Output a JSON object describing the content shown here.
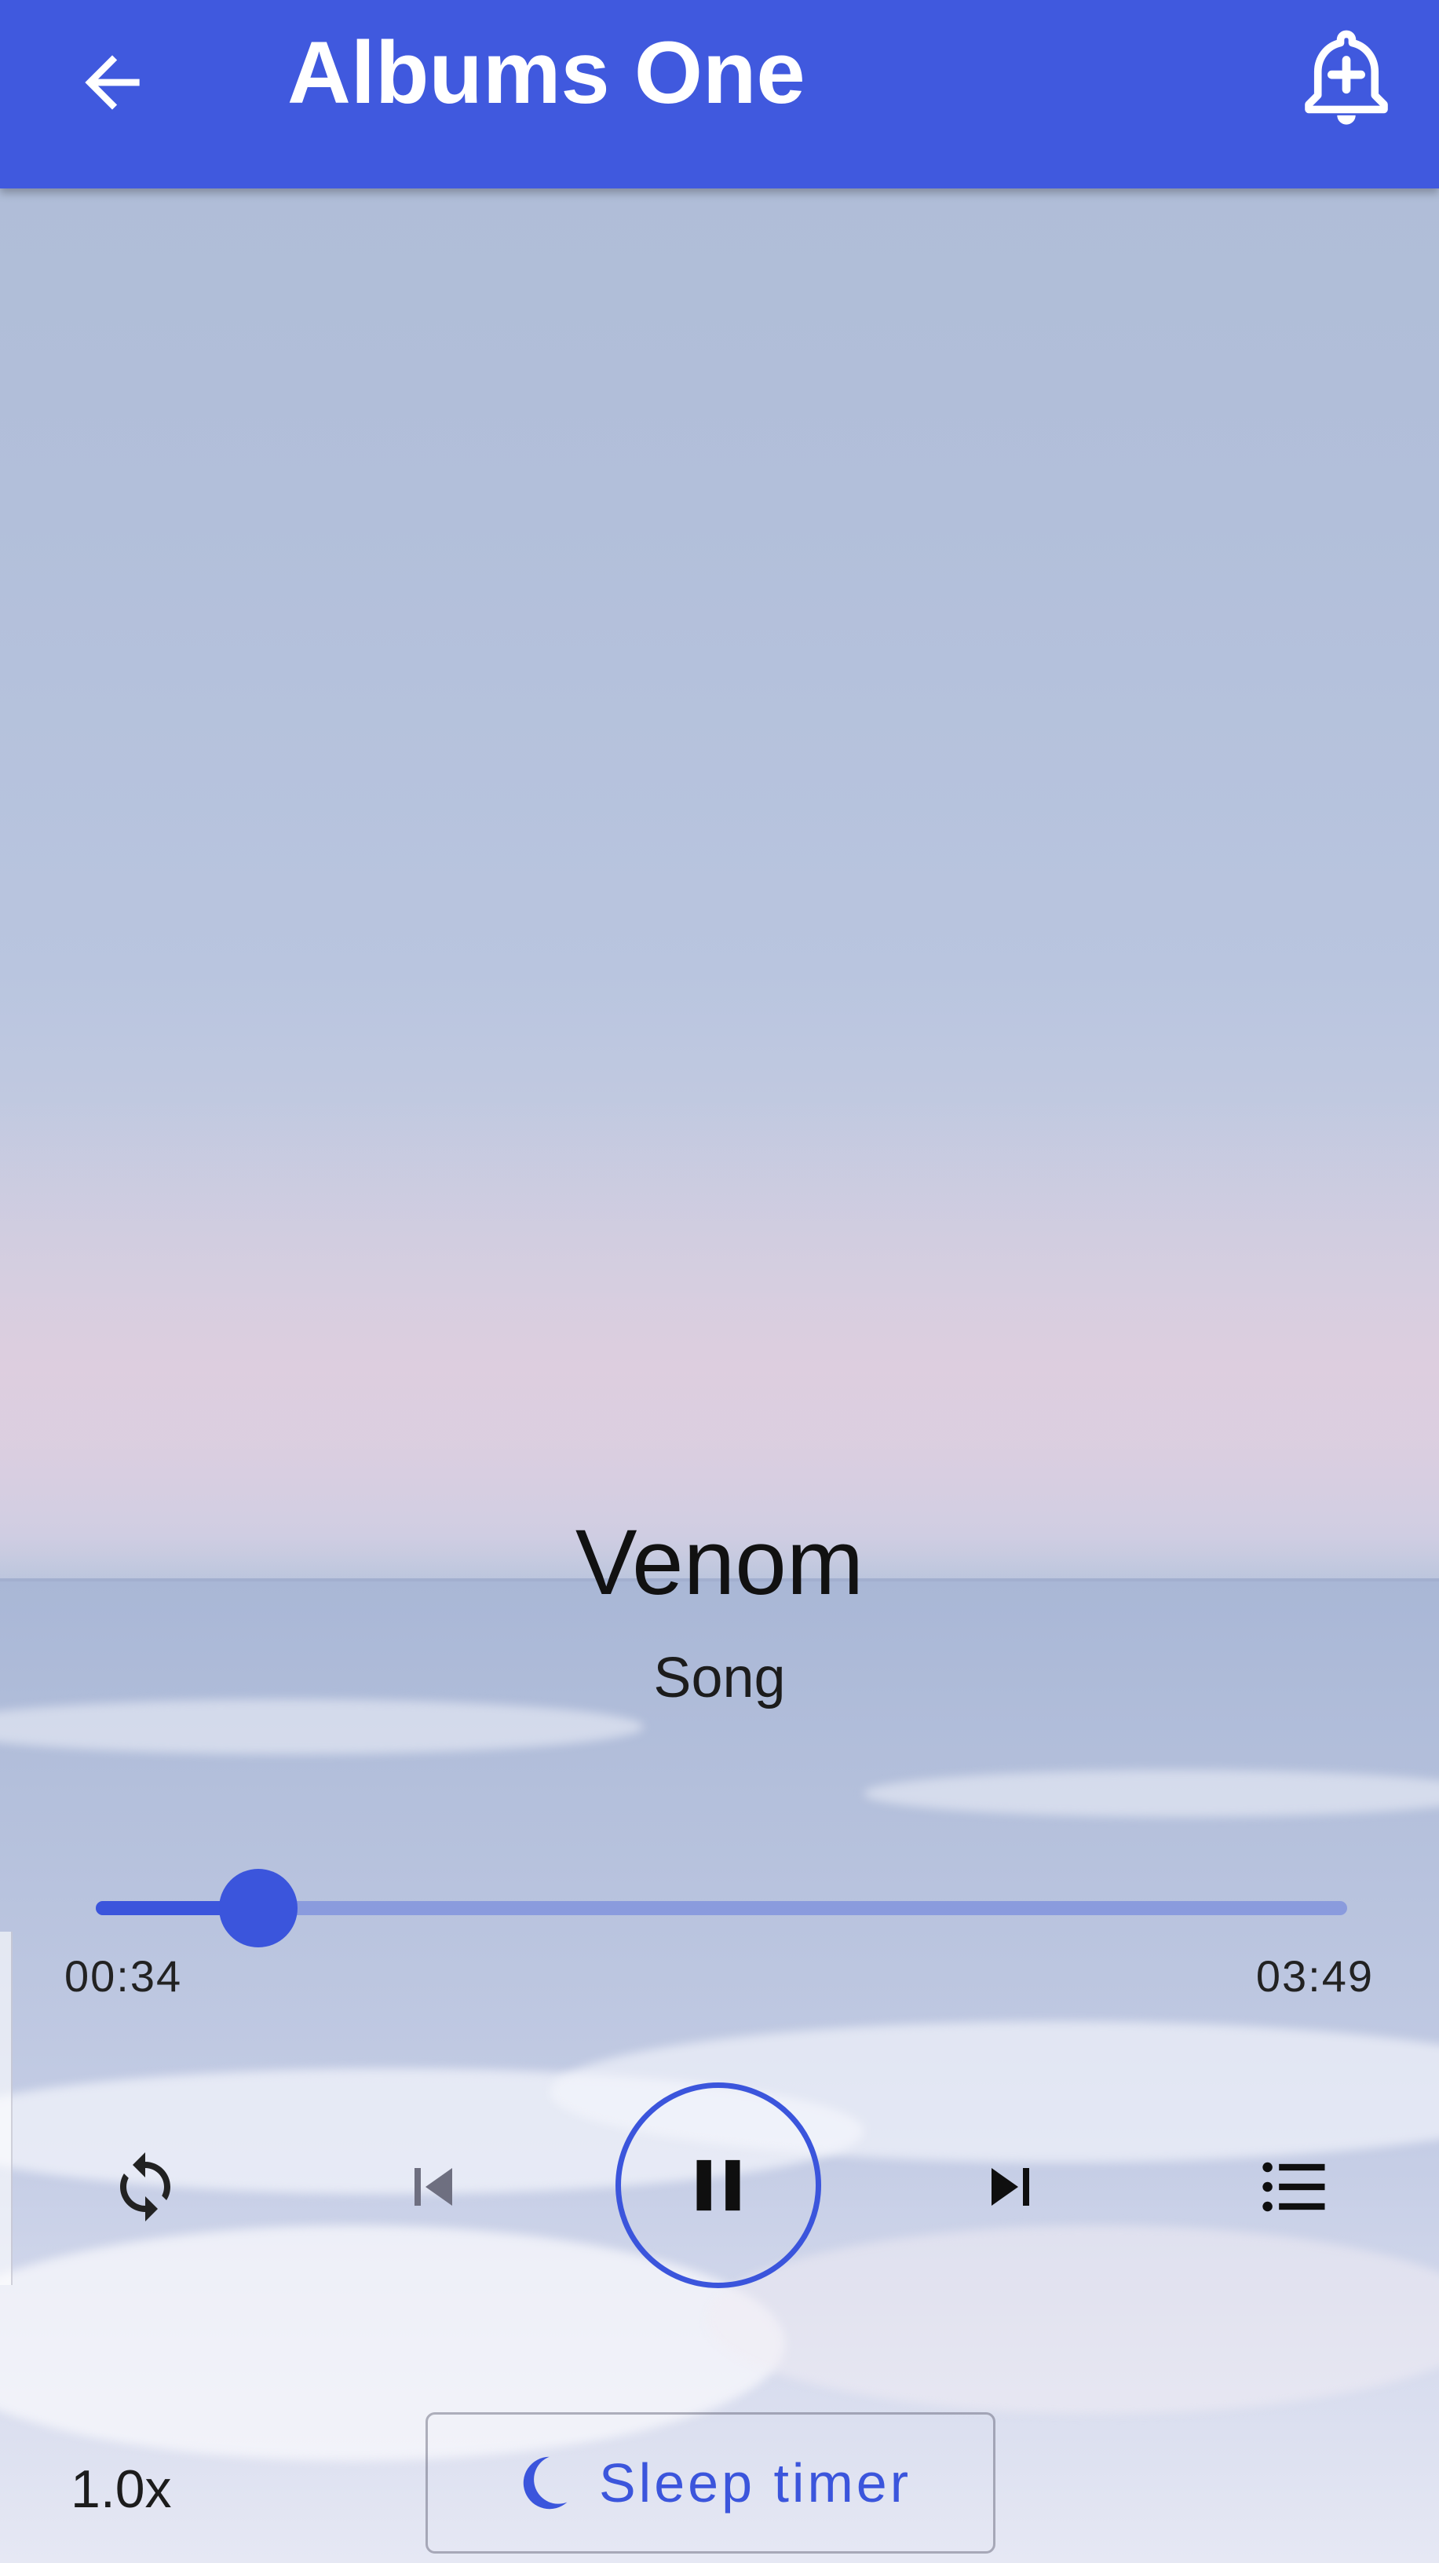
{
  "appbar": {
    "title": "Albums One",
    "back_icon": "arrow-back-icon",
    "action_icon": "alarm-add-icon",
    "color": "#4059de"
  },
  "track": {
    "title": "Venom",
    "subtitle": "Song"
  },
  "progress": {
    "current": "00:34",
    "total": "03:49",
    "fraction": 0.13
  },
  "controls": {
    "repeat_icon": "repeat-icon",
    "previous_icon": "skip-previous-icon",
    "play_pause_icon": "pause-icon",
    "next_icon": "skip-next-icon",
    "queue_icon": "queue-list-icon"
  },
  "footer": {
    "speed_label": "1.0x",
    "sleep_label": "Sleep timer",
    "sleep_icon": "moon-icon"
  },
  "colors": {
    "accent": "#3b55dc",
    "text": "#111111"
  }
}
